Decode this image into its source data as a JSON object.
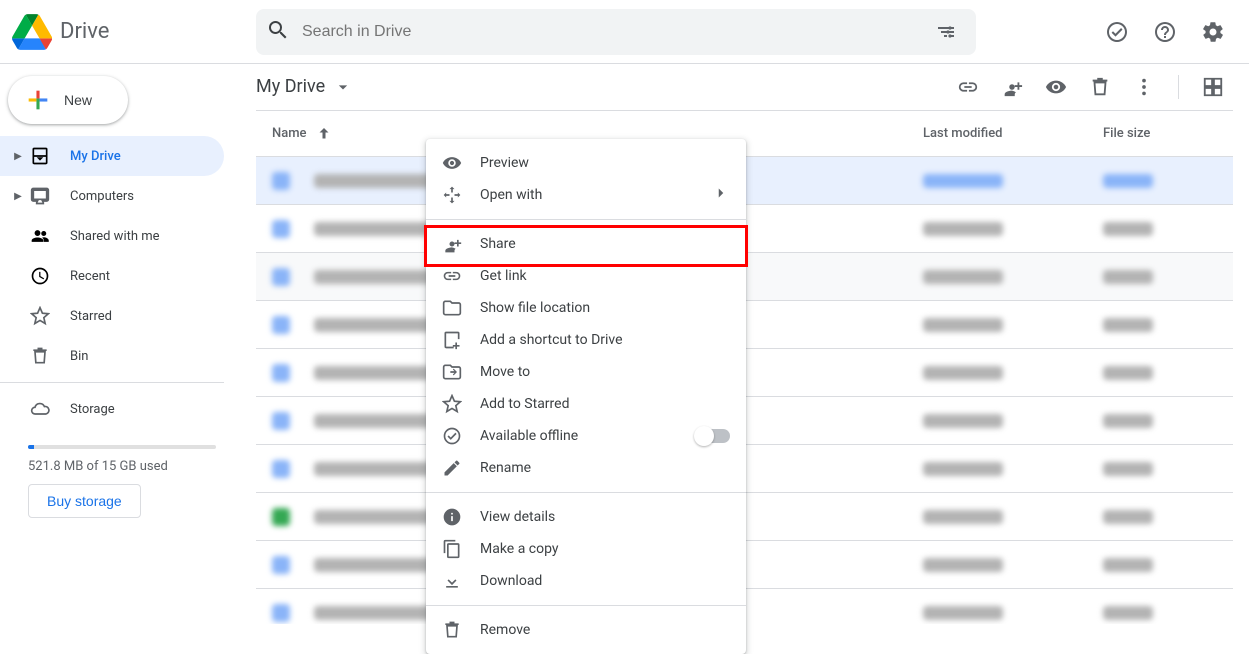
{
  "app": {
    "name": "Drive"
  },
  "search": {
    "placeholder": "Search in Drive"
  },
  "new_button": "New",
  "sidebar": {
    "items": [
      {
        "label": "My Drive"
      },
      {
        "label": "Computers"
      },
      {
        "label": "Shared with me"
      },
      {
        "label": "Recent"
      },
      {
        "label": "Starred"
      },
      {
        "label": "Bin"
      }
    ],
    "storage_label": "Storage",
    "storage_used": "521.8 MB of 15 GB used",
    "buy_storage": "Buy storage"
  },
  "main": {
    "breadcrumb": "My Drive",
    "columns": {
      "name": "Name",
      "modified": "Last modified",
      "size": "File size"
    }
  },
  "context_menu": {
    "preview": "Preview",
    "open_with": "Open with",
    "share": "Share",
    "get_link": "Get link",
    "show_location": "Show file location",
    "add_shortcut": "Add a shortcut to Drive",
    "move_to": "Move to",
    "add_starred": "Add to Starred",
    "available_offline": "Available offline",
    "rename": "Rename",
    "view_details": "View details",
    "make_copy": "Make a copy",
    "download": "Download",
    "remove": "Remove"
  }
}
